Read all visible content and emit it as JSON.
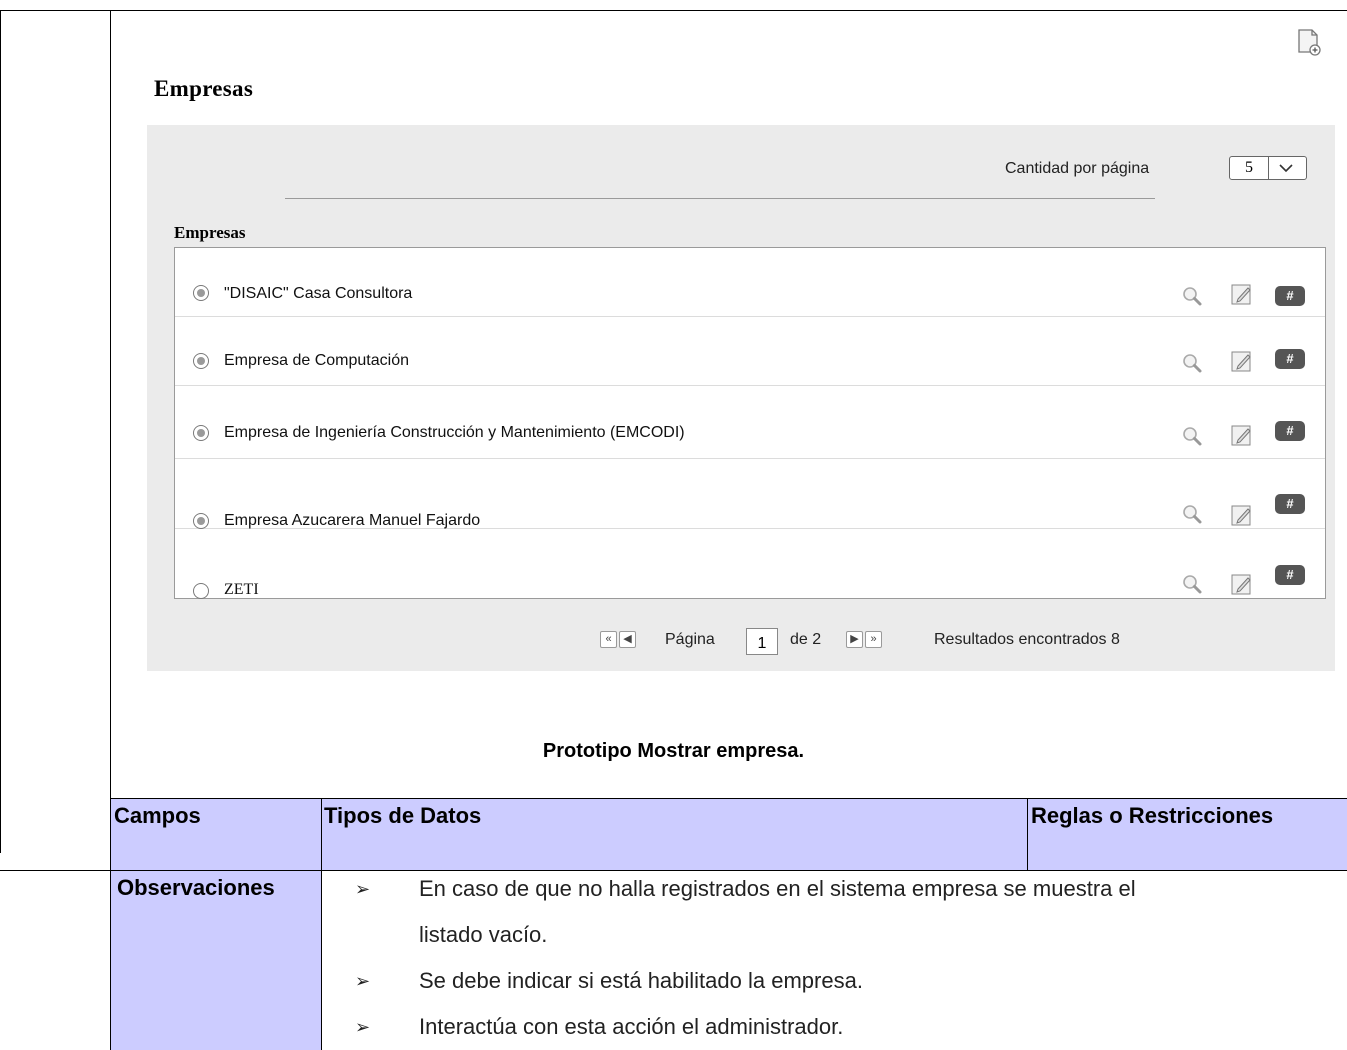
{
  "header": {
    "title": "Empresas"
  },
  "toolbar": {
    "new_icon": "new-document-icon"
  },
  "panel": {
    "per_page_label": "Cantidad por página",
    "per_page_value": "5",
    "list_title": "Empresas",
    "rows": [
      {
        "label": "\"DISAIC\" Casa Consultora",
        "selected": true
      },
      {
        "label": "Empresa de Computación",
        "selected": true
      },
      {
        "label": "Empresa de Ingeniería Construcción y Mantenimiento (EMCODI)",
        "selected": true
      },
      {
        "label": "Empresa Azucarera Manuel Fajardo",
        "selected": true
      },
      {
        "label": "ZETI",
        "selected": false
      }
    ],
    "row_icons": {
      "view": "magnifier-icon",
      "edit": "edit-icon",
      "code": "#"
    },
    "pager": {
      "page_label": "Página",
      "current_page": "1",
      "of_label": "de 2",
      "results": "Resultados encontrados 8"
    }
  },
  "caption": "Prototipo Mostrar empresa.",
  "table": {
    "headers": [
      "Campos",
      "Tipos de Datos",
      "Reglas o Restricciones"
    ],
    "observations_label": "Observaciones",
    "observations": [
      "En caso de que no halla registrados en el sistema empresa se muestra el",
      "listado vacío.",
      "Se debe indicar si está habilitado la empresa.",
      "Interactúa con esta acción el administrador."
    ]
  },
  "colors": {
    "table_header": "#ccccff",
    "panel_bg": "#ebebeb"
  }
}
